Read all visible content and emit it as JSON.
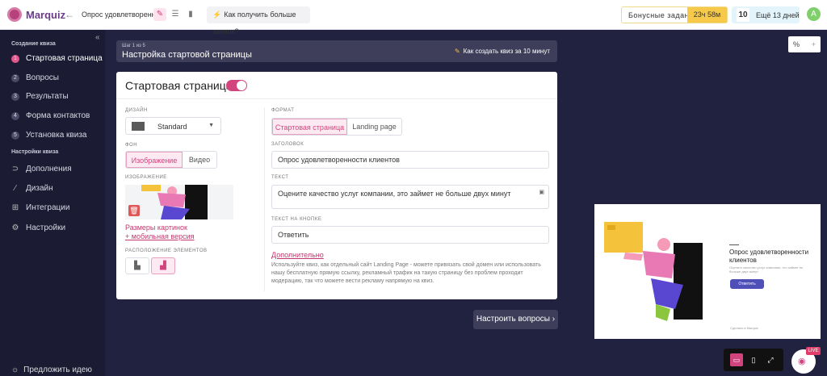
{
  "header": {
    "logo": "Marquiz",
    "back": "←",
    "quiz_name": "Опрос удовлетворенн...",
    "tip": "Как получить больше заявок?",
    "bonus_label": "Бонусные задания",
    "bonus_time": "23ч 58м",
    "days_count": "10",
    "days_text": "Ещё 13 дней",
    "avatar": "A"
  },
  "sidebar": {
    "group1": "Создание квиза",
    "items1": [
      {
        "num": "1",
        "label": "Стартовая страница"
      },
      {
        "num": "2",
        "label": "Вопросы"
      },
      {
        "num": "3",
        "label": "Результаты"
      },
      {
        "num": "4",
        "label": "Форма контактов"
      },
      {
        "num": "5",
        "label": "Установка квиза"
      }
    ],
    "group2": "Настройки квиза",
    "items2": [
      {
        "icon": "plug-icon",
        "label": "Дополнения"
      },
      {
        "icon": "brush-icon",
        "label": "Дизайн"
      },
      {
        "icon": "integration-icon",
        "label": "Интеграции"
      },
      {
        "icon": "gear-icon",
        "label": "Настройки"
      }
    ],
    "suggest": "Предложить идею"
  },
  "step": {
    "counter": "Шаг 1 из 5",
    "title": "Настройка стартовой страницы",
    "help": "Как создать квиз за 10 минут"
  },
  "card": {
    "title": "Стартовая страница",
    "toggle_on": true
  },
  "left": {
    "design_label": "ДИЗАЙН",
    "design_value": "Standard",
    "bg_label": "ФОН",
    "bg_options": [
      "Изображение",
      "Видео"
    ],
    "bg_selected": "Изображение",
    "image_label": "ИЗОБРАЖЕНИЕ",
    "sizes_link": "Размеры картинок",
    "mobile_link": "+ мобильная версия",
    "layout_label": "РАСПОЛОЖЕНИЕ ЭЛЕМЕНТОВ"
  },
  "right": {
    "format_label": "ФОРМАТ",
    "format_options": [
      "Стартовая страница",
      "Landing page"
    ],
    "format_selected": "Стартовая страница",
    "heading_label": "ЗАГОЛОВОК",
    "heading_value": "Опрос удовлетворенности клиентов",
    "text_label": "ТЕКСТ",
    "text_value": "Оцените качество услуг компании, это займет не больше двух минут",
    "button_label": "ТЕКСТ НА КНОПКЕ",
    "button_value": "Ответить",
    "more_link": "Дополнительно",
    "help_text": "Используйте квиз, как отдельный сайт Landing Page - можете привязать свой домен или использовать нашу бесплатную прямую ссылку, рекламный трафик на такую страницу без проблем проходит модерацию, так что можете вести рекламу напрямую на квиз."
  },
  "next_button": "Настроить вопросы",
  "preview": {
    "percent": "%",
    "plus": "+",
    "title": "Опрос удовлетворенности клиентов",
    "desc": "Оцените качество услуг компании, это займет не больше двух минут",
    "button": "Ответить",
    "footer": "Сделано в Marquiz",
    "live": "LIVE"
  },
  "colors": {
    "accent": "#d2447e",
    "dark": "#212140",
    "sidebar": "#1b1b33"
  }
}
